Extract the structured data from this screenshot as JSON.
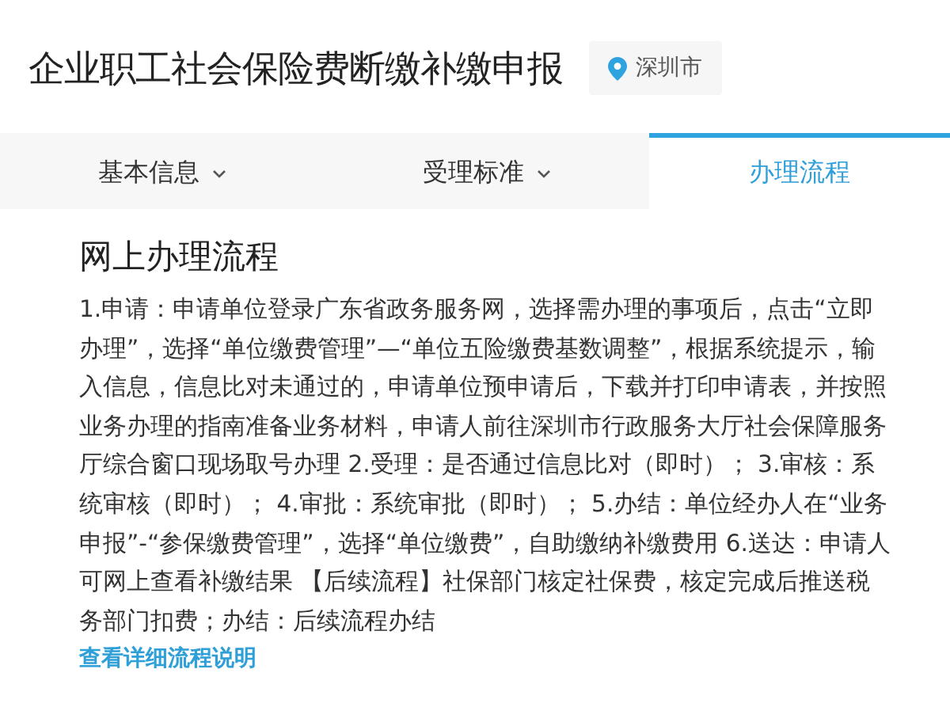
{
  "header": {
    "title": "企业职工社会保险费断缴补缴申报",
    "location": "深圳市"
  },
  "tabs": [
    {
      "label": "基本信息",
      "selected": false,
      "has_menu": true
    },
    {
      "label": "受理标准",
      "selected": false,
      "has_menu": true
    },
    {
      "label": "办理流程",
      "selected": true,
      "has_menu": false
    }
  ],
  "section": {
    "heading": "网上办理流程",
    "body": "1.申请：申请单位登录广东省政务服务网，选择需办理的事项后，点击“立即办理”，选择“单位缴费管理”—“单位五险缴费基数调整”，根据系统提示，输入信息，信息比对未通过的，申请单位预申请后，下载并打印申请表，并按照业务办理的指南准备业务材料，申请人前往深圳市行政服务大厅社会保障服务厅综合窗口现场取号办理 2.受理：是否通过信息比对（即时）； 3.审核：系统审核（即时）； 4.审批：系统审批（即时）； 5.办结：单位经办人在“业务申报”-“参保缴费管理”，选择“单位缴费”，自助缴纳补缴费用 6.送达：申请人可网上查看补缴结果 【后续流程】社保部门核定社保费，核定完成后推送税务部门扣费；办结：后续流程办结",
    "link": "查看详细流程说明"
  }
}
